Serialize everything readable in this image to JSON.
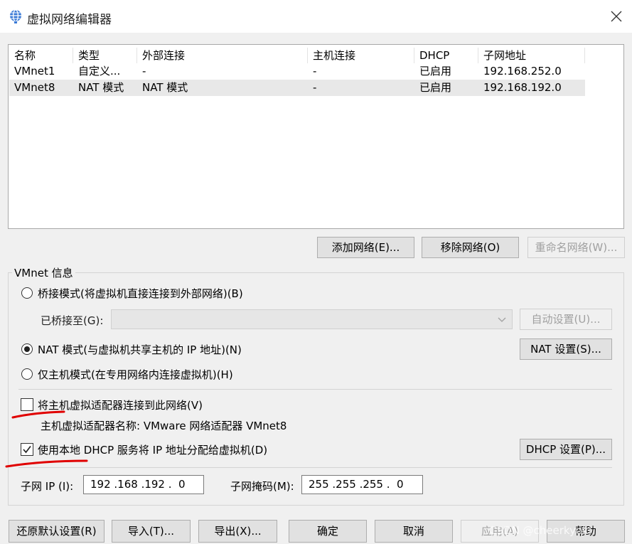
{
  "window": {
    "title": "虚拟网络编辑器",
    "icon": "network-globe-icon"
  },
  "table": {
    "columns": [
      "名称",
      "类型",
      "外部连接",
      "主机连接",
      "DHCP",
      "子网地址"
    ],
    "rows": [
      [
        "VMnet1",
        "自定义...",
        "-",
        "-",
        "已启用",
        "192.168.252.0"
      ],
      [
        "VMnet8",
        "NAT 模式",
        "NAT 模式",
        "-",
        "已启用",
        "192.168.192.0"
      ]
    ],
    "selected_row": "VMnet8"
  },
  "list_buttons": {
    "add": "添加网络(E)...",
    "remove": "移除网络(O)",
    "rename": "重命名网络(W)..."
  },
  "vmnet_info": {
    "title": "VMnet 信息",
    "bridge_mode": "桥接模式(将虚拟机直接连接到外部网络)(B)",
    "bridged_to_label": "已桥接至(G):",
    "bridged_to_value": "",
    "auto_settings": "自动设置(U)...",
    "nat_mode": "NAT 模式(与虚拟机共享主机的 IP 地址)(N)",
    "nat_settings": "NAT 设置(S)...",
    "host_only": "仅主机模式(在专用网络内连接虚拟机)(H)",
    "selected_mode": "nat",
    "connect_adapter": "将主机虚拟适配器连接到此网络(V)",
    "connect_adapter_checked": false,
    "adapter_name": "主机虚拟适配器名称: VMware 网络适配器 VMnet8",
    "use_dhcp": "使用本地 DHCP 服务将 IP 地址分配给虚拟机(D)",
    "use_dhcp_checked": true,
    "dhcp_settings": "DHCP 设置(P)...",
    "subnet_ip_label": "子网 IP (I):",
    "subnet_ip": "192 .168 .192 .  0",
    "subnet_mask_label": "子网掩码(M):",
    "subnet_mask": "255 .255 .255 .  0"
  },
  "footer": {
    "restore": "还原默认设置(R)",
    "import": "导入(T)...",
    "export": "导出(X)...",
    "ok": "确定",
    "cancel": "取消",
    "apply": "应用(A)",
    "help": "帮助"
  },
  "watermark": "CSDN @cheerkyoki",
  "colors": {
    "annotation_red": "#e00000",
    "selected_row": "#e8e8e8"
  }
}
